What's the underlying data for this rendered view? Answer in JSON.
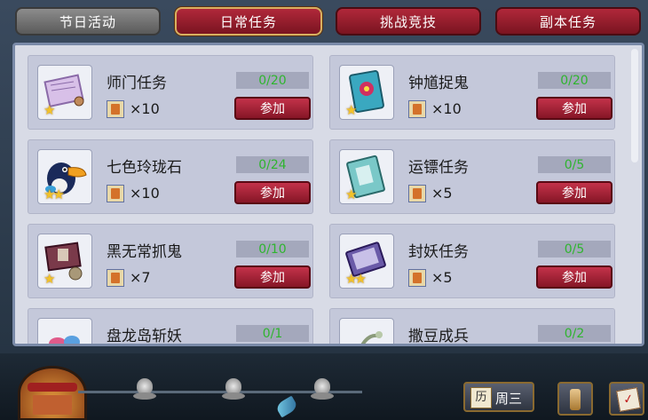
{
  "tabs": [
    "节日活动",
    "日常任务",
    "挑战竞技",
    "副本任务"
  ],
  "tasks": [
    {
      "title": "师门任务",
      "progress": "0/20",
      "reward": "×10",
      "join": "参加",
      "icon": "scroll-icon",
      "stars": "★"
    },
    {
      "title": "钟馗捉鬼",
      "progress": "0/20",
      "reward": "×10",
      "join": "参加",
      "icon": "ghost-scroll-icon",
      "stars": "★"
    },
    {
      "title": "七色玲珑石",
      "progress": "0/24",
      "reward": "×10",
      "join": "参加",
      "icon": "toucan-icon",
      "stars": "★★"
    },
    {
      "title": "运镖任务",
      "progress": "0/5",
      "reward": "×5",
      "join": "参加",
      "icon": "escort-book-icon",
      "stars": "★"
    },
    {
      "title": "黑无常抓鬼",
      "progress": "0/10",
      "reward": "×7",
      "join": "参加",
      "icon": "ghost-stamp-icon",
      "stars": "★"
    },
    {
      "title": "封妖任务",
      "progress": "0/5",
      "reward": "×5",
      "join": "参加",
      "icon": "sealed-book-icon",
      "stars": "★★"
    },
    {
      "title": "盘龙岛斩妖",
      "progress": "0/1",
      "reward": "",
      "join": "",
      "icon": "treasure-icon",
      "stars": ""
    },
    {
      "title": "撒豆成兵",
      "progress": "0/2",
      "reward": "",
      "join": "",
      "icon": "beans-icon",
      "stars": ""
    }
  ],
  "bottom": {
    "calendar_day": "三",
    "calendar_label": "周三",
    "calendar_char": "历"
  },
  "colors": {
    "progress_green": "#2fb52f",
    "button_red": "#a8213a",
    "panel": "#d8dbe6"
  }
}
